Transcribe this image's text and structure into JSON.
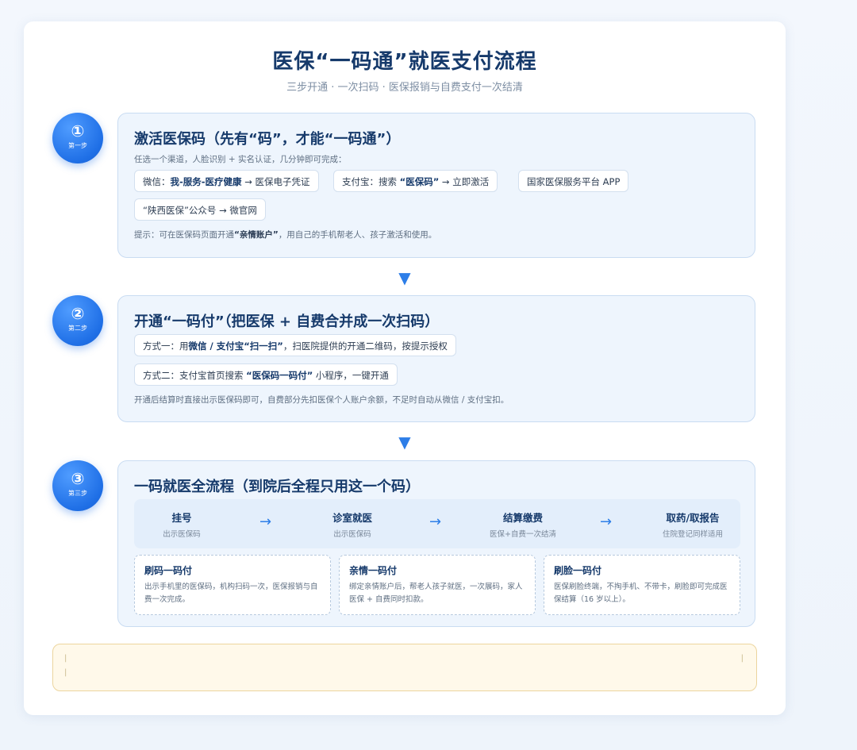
{
  "header": {
    "title": "医保“一码通”就医支付流程",
    "subtitle": "三步开通 · 一次扫码 · 医保报销与自费支付一次结清"
  },
  "steps": [
    {
      "badge_num": "①",
      "badge_label": "第一步",
      "title": "激活医保码（先有“码”，才能“一码通”）",
      "intro": "任选一个渠道，人脸识别 + 实名认证，几分钟即可完成：",
      "channels": [
        {
          "pre": "微信：",
          "bold": "我-服务-医疗健康",
          "post": " → 医保电子凭证"
        },
        {
          "pre": "支付宝：搜索 ",
          "bold": "“医保码”",
          "post": " → 立即激活"
        },
        {
          "pre": "国家医保服务平台 APP",
          "bold": "",
          "post": ""
        },
        {
          "pre": "“陕西医保”公众号 → 微官网",
          "bold": "",
          "post": ""
        }
      ],
      "tip_pre": "提示：可在医保码页面开通",
      "tip_bold": "“亲情账户”",
      "tip_post": "，用自己的手机帮老人、孩子激活和使用。"
    },
    {
      "badge_num": "②",
      "badge_label": "第二步",
      "title": "开通“一码付”（把医保 + 自费合并成一次扫码）",
      "methods": [
        {
          "pre": "方式一：用",
          "bold": "微信 / 支付宝“扫一扫”",
          "post": "，扫医院提供的开通二维码，按提示授权"
        },
        {
          "pre": "方式二：支付宝首页搜索 ",
          "bold": "“医保码一码付”",
          "post": " 小程序，一键开通"
        }
      ],
      "note": "开通后结算时直接出示医保码即可，自费部分先扣医保个人账户余额，不足时自动从微信 / 支付宝扣。"
    },
    {
      "badge_num": "③",
      "badge_label": "第三步",
      "title": "一码就医全流程（到院后全程只用这一个码）",
      "flow": [
        {
          "title": "挂号",
          "sub": "出示医保码"
        },
        {
          "title": "诊室就医",
          "sub": "出示医保码"
        },
        {
          "title": "结算缴费",
          "sub": "医保+自费一次结清"
        },
        {
          "title": "取药/取报告",
          "sub": "住院登记同样适用"
        }
      ],
      "flow_arrow": "→",
      "cards": [
        {
          "title": "刷码一码付",
          "text": "出示手机里的医保码，机构扫码一次，医保报销与自费一次完成。"
        },
        {
          "title": "亲情一码付",
          "text": "绑定亲情账户后，帮老人孩子就医，一次展码，家人医保 + 自费同时扣款。"
        },
        {
          "title": "刷脸一码付",
          "text": "医保刷脸终端，不掏手机、不带卡，刷脸即可完成医保结算（16 岁以上）。"
        }
      ]
    }
  ],
  "between_arrow": "▼",
  "footer": {
    "marks": [
      "|",
      "|",
      "|"
    ]
  }
}
